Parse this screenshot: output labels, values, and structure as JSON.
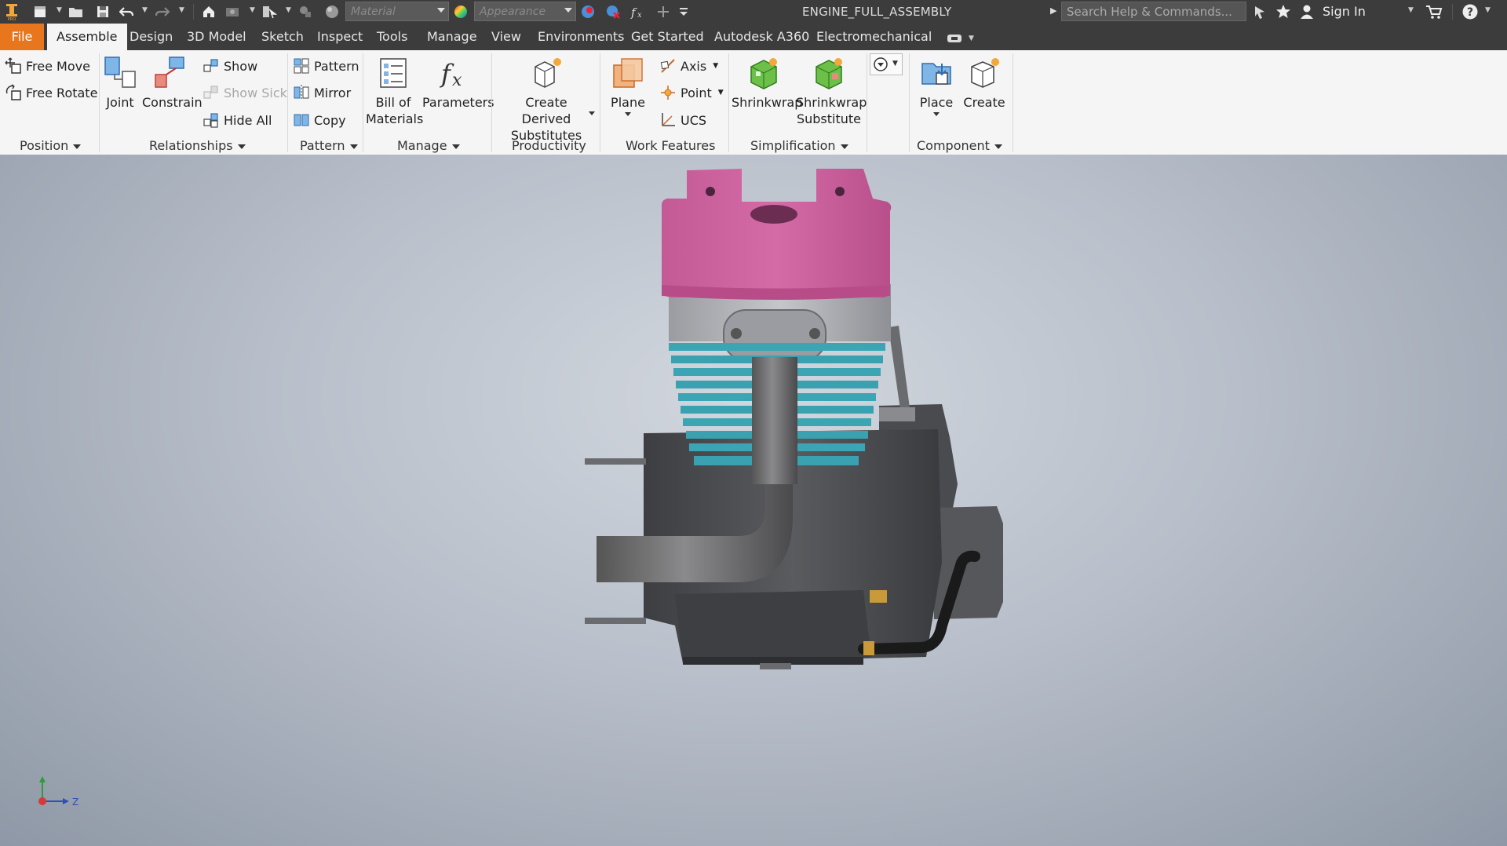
{
  "window": {
    "document_title": "ENGINE_FULL_ASSEMBLY",
    "material_placeholder": "Material",
    "appearance_placeholder": "Appearance",
    "search_placeholder": "Search Help & Commands...",
    "sign_in": "Sign In"
  },
  "tabs": {
    "file": "File",
    "assemble": "Assemble",
    "design": "Design",
    "model3d": "3D Model",
    "sketch": "Sketch",
    "inspect": "Inspect",
    "tools": "Tools",
    "manage": "Manage",
    "view": "View",
    "environments": "Environments",
    "get_started": "Get Started",
    "a360": "Autodesk A360",
    "electromechanical": "Electromechanical"
  },
  "ribbon": {
    "position": {
      "title": "Position",
      "free_move": "Free Move",
      "free_rotate": "Free Rotate"
    },
    "relationships": {
      "title": "Relationships",
      "joint": "Joint",
      "constrain": "Constrain",
      "show": "Show",
      "show_sick": "Show Sick",
      "hide_all": "Hide All"
    },
    "pattern": {
      "title": "Pattern",
      "pattern": "Pattern",
      "mirror": "Mirror",
      "copy": "Copy"
    },
    "manage": {
      "title": "Manage",
      "bom_line1": "Bill of",
      "bom_line2": "Materials",
      "parameters": "Parameters"
    },
    "productivity": {
      "title": "Productivity",
      "derived_line1": "Create Derived",
      "derived_line2": "Substitutes"
    },
    "work_features": {
      "title": "Work Features",
      "plane": "Plane",
      "axis": "Axis",
      "point": "Point",
      "ucs": "UCS"
    },
    "simplification": {
      "title": "Simplification",
      "shrinkwrap": "Shrinkwrap",
      "sw_sub_line1": "Shrinkwrap",
      "sw_sub_line2": "Substitute"
    },
    "component": {
      "title": "Component",
      "place": "Place",
      "create": "Create"
    }
  },
  "viewcube": {
    "z_label": "Z"
  },
  "colors": {
    "titlebar": "#3c3c3c",
    "file_tab": "#e8761d",
    "ribbon_bg": "#f5f5f5",
    "head_color": "#cc5e9b",
    "fins_color": "#3ca5b4",
    "body_color": "#4a4b4e"
  }
}
